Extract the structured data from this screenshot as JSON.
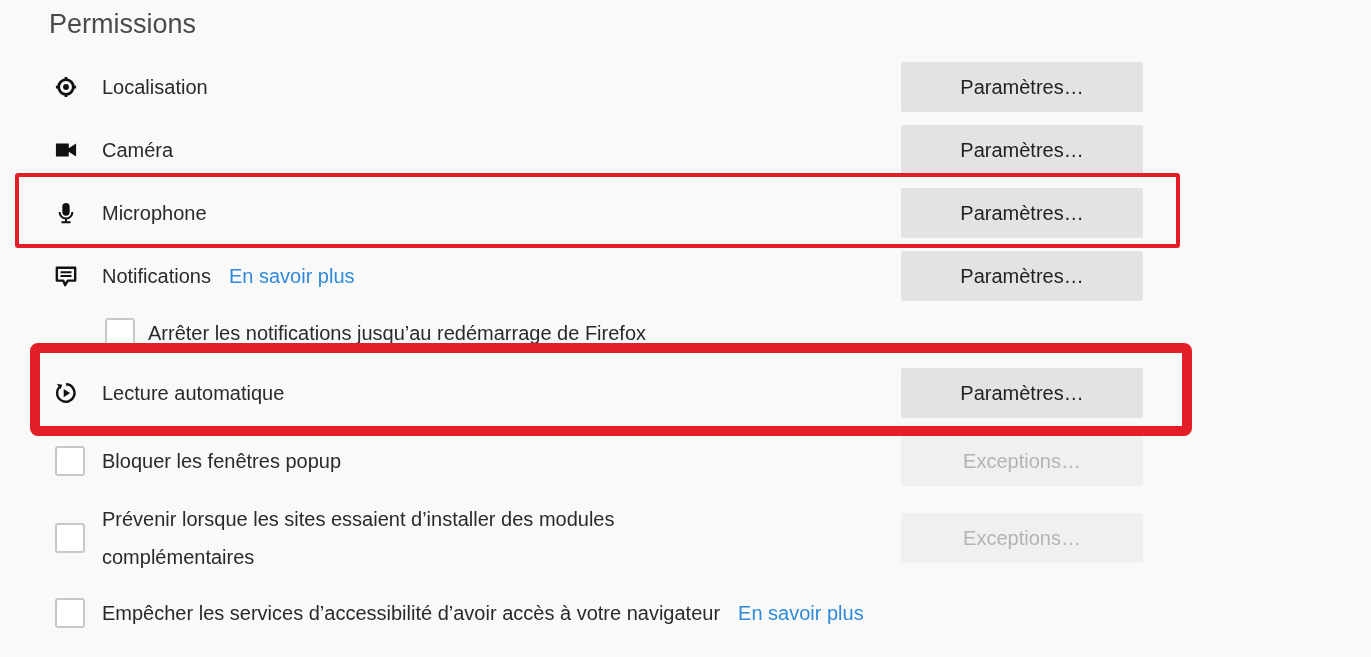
{
  "section": {
    "title": "Permissions"
  },
  "rows": [
    {
      "kind": "permission",
      "label": "Localisation",
      "button": {
        "label": "Paramètres…",
        "disabled": false
      }
    },
    {
      "kind": "permission",
      "label": "Caméra",
      "button": {
        "label": "Paramètres…",
        "disabled": false
      }
    },
    {
      "kind": "permission",
      "label": "Microphone",
      "highlight": {
        "kind": "thin"
      },
      "button": {
        "label": "Paramètres…",
        "disabled": false
      }
    },
    {
      "kind": "permission",
      "label": "Notifications",
      "link": "En savoir plus",
      "button": {
        "label": "Paramètres…",
        "disabled": false
      },
      "children": [
        {
          "kind": "checkbox",
          "label": "Arrêter les notifications jusqu’au redémarrage de Firefox",
          "checked": false
        }
      ]
    },
    {
      "kind": "permission",
      "label": "Lecture automatique",
      "highlight": {
        "kind": "thick"
      },
      "button": {
        "label": "Paramètres…",
        "disabled": false
      }
    },
    {
      "kind": "checkbox",
      "label": "Bloquer les fenêtres popup",
      "checked": false,
      "button": {
        "label": "Exceptions…",
        "disabled": true
      }
    },
    {
      "kind": "checkbox",
      "label": "Prévenir lorsque les sites essaient d’installer des modules complémentaires",
      "checked": false,
      "button": {
        "label": "Exceptions…",
        "disabled": true
      }
    },
    {
      "kind": "checkbox",
      "label": "Empêcher les services d’accessibilité d’avoir accès à votre navigateur",
      "checked": false,
      "link": "En savoir plus"
    }
  ]
}
